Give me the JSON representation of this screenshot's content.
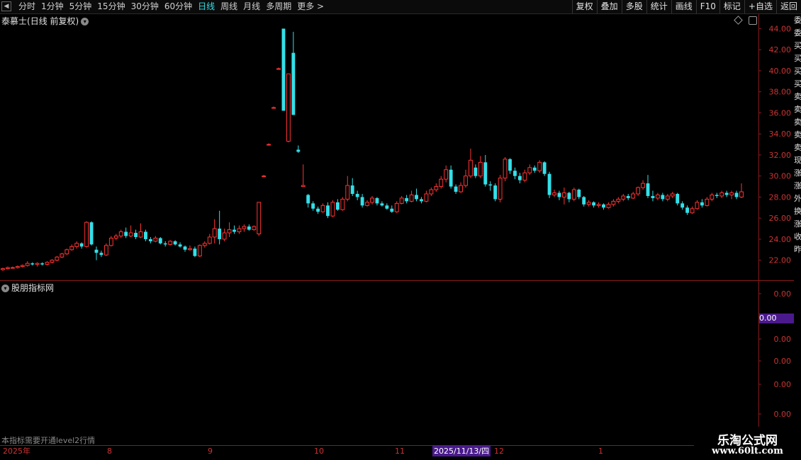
{
  "toolbar": {
    "periods": [
      "分时",
      "1分钟",
      "5分钟",
      "15分钟",
      "30分钟",
      "60分钟",
      "日线",
      "周线",
      "月线",
      "多周期",
      "更多 >"
    ],
    "active_period": "日线",
    "tools": [
      "复权",
      "叠加",
      "多股",
      "统计",
      "画线",
      "F10",
      "标记",
      "+自选",
      "返回"
    ]
  },
  "main_chart": {
    "stock_name": "泰慕士",
    "title_suffix": "(日线 前复权)",
    "price_ticks": [
      "44.00",
      "42.00",
      "40.00",
      "38.00",
      "36.00",
      "34.00",
      "32.00",
      "30.00",
      "28.00",
      "26.00",
      "24.00",
      "22.00"
    ]
  },
  "indicator": {
    "title": "股朋指标网",
    "value_box": "0.00",
    "ticks": [
      "0.00",
      "0.00",
      "0.00",
      "0.00",
      "0.00"
    ],
    "notice": "本指标需要开通level2行情"
  },
  "date_axis": {
    "labels": [
      "2025年",
      "8",
      "9",
      "10",
      "11",
      "12",
      "1"
    ],
    "cursor_date": "2025/11/13/四"
  },
  "right_edge_glyphs": [
    "委",
    "委",
    "买",
    "买",
    "买",
    "买",
    "卖",
    "卖",
    "卖",
    "卖",
    "卖",
    "现",
    "涨",
    "涨",
    "外",
    "换",
    "涨",
    "收",
    "昨"
  ],
  "watermark": {
    "brand": "乐淘公式网",
    "url": "www.60lt.com"
  },
  "colors": {
    "up": "#ff3333",
    "down": "#33e0e8",
    "active": "#33e0e8",
    "grid": "#8a1a1a",
    "highlight": "#4a1a8c"
  },
  "chart_data": {
    "type": "candlestick",
    "ylim": [
      20.5,
      44.3
    ],
    "candles": [
      {
        "o": 21.1,
        "c": 21.2,
        "h": 21.3,
        "l": 21.0
      },
      {
        "o": 21.2,
        "c": 21.3,
        "h": 21.4,
        "l": 21.1
      },
      {
        "o": 21.3,
        "c": 21.3,
        "h": 21.4,
        "l": 21.2
      },
      {
        "o": 21.3,
        "c": 21.4,
        "h": 21.5,
        "l": 21.2
      },
      {
        "o": 21.4,
        "c": 21.5,
        "h": 21.6,
        "l": 21.3
      },
      {
        "o": 21.5,
        "c": 21.7,
        "h": 21.9,
        "l": 21.4
      },
      {
        "o": 21.7,
        "c": 21.6,
        "h": 21.8,
        "l": 21.5
      },
      {
        "o": 21.6,
        "c": 21.7,
        "h": 21.8,
        "l": 21.4
      },
      {
        "o": 21.7,
        "c": 21.6,
        "h": 21.8,
        "l": 21.5
      },
      {
        "o": 21.6,
        "c": 21.8,
        "h": 21.9,
        "l": 21.5
      },
      {
        "o": 21.8,
        "c": 22.0,
        "h": 22.1,
        "l": 21.7
      },
      {
        "o": 22.0,
        "c": 22.3,
        "h": 22.4,
        "l": 21.9
      },
      {
        "o": 22.3,
        "c": 22.6,
        "h": 22.7,
        "l": 22.2
      },
      {
        "o": 22.6,
        "c": 23.0,
        "h": 23.1,
        "l": 22.5
      },
      {
        "o": 23.0,
        "c": 23.3,
        "h": 23.5,
        "l": 22.9
      },
      {
        "o": 23.3,
        "c": 23.6,
        "h": 23.8,
        "l": 23.1
      },
      {
        "o": 23.6,
        "c": 23.3,
        "h": 23.7,
        "l": 23.1
      },
      {
        "o": 23.3,
        "c": 25.6,
        "h": 25.7,
        "l": 23.2
      },
      {
        "o": 25.6,
        "c": 23.5,
        "h": 25.7,
        "l": 23.4
      },
      {
        "o": 23.0,
        "c": 22.7,
        "h": 23.3,
        "l": 22.0
      },
      {
        "o": 22.7,
        "c": 22.5,
        "h": 22.9,
        "l": 22.3
      },
      {
        "o": 22.5,
        "c": 23.4,
        "h": 23.6,
        "l": 22.4
      },
      {
        "o": 23.4,
        "c": 24.1,
        "h": 24.3,
        "l": 23.3
      },
      {
        "o": 24.1,
        "c": 24.3,
        "h": 24.5,
        "l": 23.9
      },
      {
        "o": 24.3,
        "c": 24.7,
        "h": 24.9,
        "l": 24.1
      },
      {
        "o": 24.7,
        "c": 24.3,
        "h": 25.1,
        "l": 24.1
      },
      {
        "o": 24.3,
        "c": 24.6,
        "h": 25.3,
        "l": 24.2
      },
      {
        "o": 24.6,
        "c": 24.2,
        "h": 24.9,
        "l": 24.0
      },
      {
        "o": 24.2,
        "c": 24.7,
        "h": 25.5,
        "l": 24.1
      },
      {
        "o": 24.7,
        "c": 24.0,
        "h": 24.9,
        "l": 23.8
      },
      {
        "o": 24.0,
        "c": 23.8,
        "h": 24.2,
        "l": 23.6
      },
      {
        "o": 23.8,
        "c": 24.1,
        "h": 24.3,
        "l": 23.7
      },
      {
        "o": 24.1,
        "c": 23.6,
        "h": 24.2,
        "l": 23.5
      },
      {
        "o": 23.6,
        "c": 23.5,
        "h": 23.8,
        "l": 23.3
      },
      {
        "o": 23.5,
        "c": 23.8,
        "h": 23.9,
        "l": 23.4
      },
      {
        "o": 23.8,
        "c": 23.5,
        "h": 23.9,
        "l": 23.4
      },
      {
        "o": 23.5,
        "c": 23.3,
        "h": 23.7,
        "l": 23.2
      },
      {
        "o": 23.3,
        "c": 23.0,
        "h": 23.4,
        "l": 22.8
      },
      {
        "o": 23.0,
        "c": 23.1,
        "h": 23.4,
        "l": 22.9
      },
      {
        "o": 23.1,
        "c": 22.4,
        "h": 23.3,
        "l": 22.3
      },
      {
        "o": 22.4,
        "c": 23.4,
        "h": 23.5,
        "l": 22.3
      },
      {
        "o": 23.4,
        "c": 23.6,
        "h": 23.8,
        "l": 23.2
      },
      {
        "o": 23.6,
        "c": 24.2,
        "h": 24.5,
        "l": 23.5
      },
      {
        "o": 24.2,
        "c": 25.0,
        "h": 25.9,
        "l": 23.6
      },
      {
        "o": 25.0,
        "c": 24.0,
        "h": 26.7,
        "l": 23.5
      },
      {
        "o": 24.0,
        "c": 24.6,
        "h": 25.0,
        "l": 23.8
      },
      {
        "o": 24.6,
        "c": 24.9,
        "h": 25.6,
        "l": 24.2
      },
      {
        "o": 24.9,
        "c": 24.7,
        "h": 25.3,
        "l": 24.5
      },
      {
        "o": 24.7,
        "c": 25.0,
        "h": 25.3,
        "l": 24.5
      },
      {
        "o": 25.0,
        "c": 25.2,
        "h": 25.4,
        "l": 24.7
      },
      {
        "o": 25.2,
        "c": 24.9,
        "h": 25.4,
        "l": 24.8
      },
      {
        "o": 24.9,
        "c": 25.2,
        "h": 25.3,
        "l": 24.8
      },
      {
        "o": 24.5,
        "c": 27.5,
        "h": 27.5,
        "l": 24.3
      },
      {
        "o": 30.0,
        "c": 30.0,
        "h": 30.1,
        "l": 29.9
      },
      {
        "o": 33.0,
        "c": 33.0,
        "h": 33.1,
        "l": 32.9
      },
      {
        "o": 36.5,
        "c": 36.5,
        "h": 36.6,
        "l": 36.4
      },
      {
        "o": 40.2,
        "c": 40.2,
        "h": 40.3,
        "l": 40.1
      },
      {
        "o": 44.0,
        "c": 36.2,
        "h": 44.0,
        "l": 36.2
      },
      {
        "o": 33.3,
        "c": 39.7,
        "h": 39.7,
        "l": 33.2
      },
      {
        "o": 41.7,
        "c": 35.8,
        "h": 43.7,
        "l": 35.8
      },
      {
        "o": 32.5,
        "c": 32.3,
        "h": 32.9,
        "l": 32.2
      },
      {
        "o": 29.0,
        "c": 29.1,
        "h": 31.1,
        "l": 29.0
      },
      {
        "o": 28.2,
        "c": 27.4,
        "h": 28.3,
        "l": 27.0
      },
      {
        "o": 27.4,
        "c": 26.9,
        "h": 27.6,
        "l": 26.7
      },
      {
        "o": 26.9,
        "c": 26.6,
        "h": 27.1,
        "l": 26.4
      },
      {
        "o": 26.6,
        "c": 27.2,
        "h": 27.4,
        "l": 26.5
      },
      {
        "o": 27.2,
        "c": 26.2,
        "h": 27.5,
        "l": 26.0
      },
      {
        "o": 26.2,
        "c": 27.5,
        "h": 27.7,
        "l": 26.1
      },
      {
        "o": 27.5,
        "c": 26.8,
        "h": 27.8,
        "l": 26.7
      },
      {
        "o": 26.8,
        "c": 27.8,
        "h": 28.0,
        "l": 26.7
      },
      {
        "o": 27.8,
        "c": 29.1,
        "h": 30.0,
        "l": 27.6
      },
      {
        "o": 29.1,
        "c": 28.3,
        "h": 29.8,
        "l": 28.1
      },
      {
        "o": 28.3,
        "c": 28.0,
        "h": 28.6,
        "l": 27.7
      },
      {
        "o": 28.0,
        "c": 27.2,
        "h": 28.3,
        "l": 27.0
      },
      {
        "o": 27.2,
        "c": 27.5,
        "h": 27.7,
        "l": 27.1
      },
      {
        "o": 27.5,
        "c": 27.9,
        "h": 28.1,
        "l": 27.3
      },
      {
        "o": 27.9,
        "c": 27.4,
        "h": 28.0,
        "l": 27.2
      },
      {
        "o": 27.4,
        "c": 27.2,
        "h": 27.6,
        "l": 27.1
      },
      {
        "o": 27.2,
        "c": 26.9,
        "h": 27.4,
        "l": 26.8
      },
      {
        "o": 26.9,
        "c": 26.6,
        "h": 27.2,
        "l": 26.5
      },
      {
        "o": 26.6,
        "c": 27.4,
        "h": 27.6,
        "l": 26.5
      },
      {
        "o": 27.4,
        "c": 27.9,
        "h": 28.1,
        "l": 27.3
      },
      {
        "o": 27.9,
        "c": 27.6,
        "h": 28.2,
        "l": 27.4
      },
      {
        "o": 27.6,
        "c": 28.2,
        "h": 28.6,
        "l": 27.5
      },
      {
        "o": 28.2,
        "c": 27.8,
        "h": 28.8,
        "l": 27.6
      },
      {
        "o": 27.8,
        "c": 27.6,
        "h": 28.0,
        "l": 27.4
      },
      {
        "o": 27.6,
        "c": 28.3,
        "h": 28.6,
        "l": 27.5
      },
      {
        "o": 28.3,
        "c": 28.7,
        "h": 28.9,
        "l": 28.1
      },
      {
        "o": 28.7,
        "c": 29.0,
        "h": 29.3,
        "l": 28.5
      },
      {
        "o": 29.0,
        "c": 29.7,
        "h": 30.0,
        "l": 28.8
      },
      {
        "o": 29.7,
        "c": 30.6,
        "h": 31.0,
        "l": 29.4
      },
      {
        "o": 30.6,
        "c": 29.0,
        "h": 31.0,
        "l": 28.8
      },
      {
        "o": 29.0,
        "c": 28.5,
        "h": 29.2,
        "l": 28.3
      },
      {
        "o": 28.5,
        "c": 29.1,
        "h": 29.4,
        "l": 28.4
      },
      {
        "o": 29.1,
        "c": 30.0,
        "h": 30.6,
        "l": 28.9
      },
      {
        "o": 30.0,
        "c": 31.5,
        "h": 32.6,
        "l": 29.8
      },
      {
        "o": 30.8,
        "c": 30.0,
        "h": 31.1,
        "l": 29.8
      },
      {
        "o": 30.0,
        "c": 31.3,
        "h": 31.9,
        "l": 29.8
      },
      {
        "o": 31.3,
        "c": 29.2,
        "h": 32.0,
        "l": 29.0
      },
      {
        "o": 29.2,
        "c": 29.1,
        "h": 29.5,
        "l": 28.6
      },
      {
        "o": 29.1,
        "c": 27.8,
        "h": 29.3,
        "l": 27.6
      },
      {
        "o": 27.8,
        "c": 29.8,
        "h": 30.1,
        "l": 27.5
      },
      {
        "o": 29.8,
        "c": 31.6,
        "h": 31.8,
        "l": 29.5
      },
      {
        "o": 31.6,
        "c": 30.5,
        "h": 31.7,
        "l": 30.2
      },
      {
        "o": 30.5,
        "c": 30.0,
        "h": 30.8,
        "l": 29.7
      },
      {
        "o": 30.0,
        "c": 29.6,
        "h": 30.3,
        "l": 29.3
      },
      {
        "o": 29.6,
        "c": 30.3,
        "h": 30.6,
        "l": 29.4
      },
      {
        "o": 30.3,
        "c": 30.8,
        "h": 31.1,
        "l": 30.1
      },
      {
        "o": 30.8,
        "c": 30.5,
        "h": 31.0,
        "l": 30.3
      },
      {
        "o": 30.5,
        "c": 31.3,
        "h": 31.5,
        "l": 30.3
      },
      {
        "o": 31.3,
        "c": 30.2,
        "h": 31.4,
        "l": 30.0
      },
      {
        "o": 30.2,
        "c": 28.2,
        "h": 30.4,
        "l": 27.9
      },
      {
        "o": 28.2,
        "c": 28.4,
        "h": 28.7,
        "l": 28.0
      },
      {
        "o": 28.4,
        "c": 28.0,
        "h": 28.6,
        "l": 27.7
      },
      {
        "o": 28.0,
        "c": 28.4,
        "h": 28.9,
        "l": 27.3
      },
      {
        "o": 28.4,
        "c": 27.8,
        "h": 28.5,
        "l": 27.5
      },
      {
        "o": 27.8,
        "c": 28.7,
        "h": 28.9,
        "l": 27.6
      },
      {
        "o": 28.7,
        "c": 28.0,
        "h": 28.8,
        "l": 27.8
      },
      {
        "o": 28.0,
        "c": 27.3,
        "h": 28.1,
        "l": 27.1
      },
      {
        "o": 27.3,
        "c": 27.5,
        "h": 27.7,
        "l": 27.1
      },
      {
        "o": 27.5,
        "c": 27.2,
        "h": 27.6,
        "l": 27.0
      },
      {
        "o": 27.2,
        "c": 27.3,
        "h": 27.5,
        "l": 27.0
      },
      {
        "o": 27.3,
        "c": 27.0,
        "h": 27.4,
        "l": 26.8
      },
      {
        "o": 27.0,
        "c": 27.3,
        "h": 27.5,
        "l": 26.9
      },
      {
        "o": 27.3,
        "c": 27.6,
        "h": 27.8,
        "l": 27.1
      },
      {
        "o": 27.6,
        "c": 27.8,
        "h": 28.0,
        "l": 27.4
      },
      {
        "o": 27.8,
        "c": 28.1,
        "h": 28.3,
        "l": 27.6
      },
      {
        "o": 28.1,
        "c": 27.9,
        "h": 28.3,
        "l": 27.7
      },
      {
        "o": 27.9,
        "c": 28.3,
        "h": 28.5,
        "l": 27.8
      },
      {
        "o": 28.3,
        "c": 28.9,
        "h": 29.0,
        "l": 28.1
      },
      {
        "o": 28.9,
        "c": 29.3,
        "h": 29.6,
        "l": 28.7
      },
      {
        "o": 29.3,
        "c": 28.1,
        "h": 30.1,
        "l": 27.9
      },
      {
        "o": 28.1,
        "c": 27.9,
        "h": 28.6,
        "l": 27.6
      },
      {
        "o": 27.9,
        "c": 28.2,
        "h": 28.4,
        "l": 27.7
      },
      {
        "o": 28.2,
        "c": 27.8,
        "h": 28.4,
        "l": 27.6
      },
      {
        "o": 27.8,
        "c": 28.1,
        "h": 28.3,
        "l": 27.6
      },
      {
        "o": 28.1,
        "c": 28.3,
        "h": 28.5,
        "l": 27.9
      },
      {
        "o": 28.3,
        "c": 27.4,
        "h": 28.4,
        "l": 27.2
      },
      {
        "o": 27.4,
        "c": 27.0,
        "h": 27.6,
        "l": 26.8
      },
      {
        "o": 27.0,
        "c": 26.5,
        "h": 27.2,
        "l": 26.3
      },
      {
        "o": 26.5,
        "c": 26.9,
        "h": 27.1,
        "l": 26.4
      },
      {
        "o": 26.9,
        "c": 27.5,
        "h": 27.7,
        "l": 26.8
      },
      {
        "o": 27.5,
        "c": 27.2,
        "h": 27.8,
        "l": 27.0
      },
      {
        "o": 27.2,
        "c": 27.8,
        "h": 28.0,
        "l": 27.1
      },
      {
        "o": 27.8,
        "c": 28.2,
        "h": 28.4,
        "l": 27.6
      },
      {
        "o": 28.2,
        "c": 28.1,
        "h": 28.4,
        "l": 27.9
      },
      {
        "o": 28.1,
        "c": 28.4,
        "h": 28.6,
        "l": 27.9
      },
      {
        "o": 28.4,
        "c": 28.2,
        "h": 28.6,
        "l": 28.0
      },
      {
        "o": 28.2,
        "c": 28.4,
        "h": 28.6,
        "l": 27.8
      },
      {
        "o": 28.4,
        "c": 28.0,
        "h": 28.6,
        "l": 27.8
      },
      {
        "o": 28.0,
        "c": 28.5,
        "h": 29.3,
        "l": 27.9
      }
    ]
  }
}
